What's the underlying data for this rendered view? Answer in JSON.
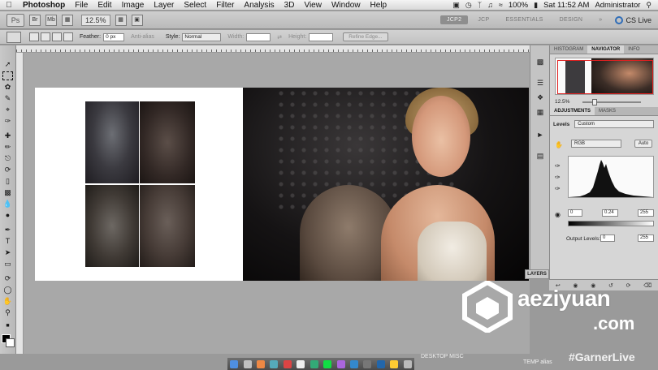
{
  "menubar": {
    "app": "Photoshop",
    "items": [
      "File",
      "Edit",
      "Image",
      "Layer",
      "Select",
      "Filter",
      "Analysis",
      "3D",
      "View",
      "Window",
      "Help"
    ],
    "battery": "100%",
    "clock": "Sat 11:52 AM",
    "user": "Administrator"
  },
  "appbar": {
    "ps": "Ps",
    "zoom": "12.5%",
    "workspaces": [
      "JCP2",
      "JCP",
      "ESSENTIALS",
      "DESIGN",
      "»"
    ],
    "cslive": "CS Live"
  },
  "options": {
    "feather_label": "Feather:",
    "feather_value": "0 px",
    "antialias": "Anti-alias",
    "style_label": "Style:",
    "style_value": "Normal",
    "width_label": "Width:",
    "height_label": "Height:",
    "refine": "Refine Edge..."
  },
  "panels": {
    "top_tabs": [
      "HISTOGRAM",
      "NAVIGATOR",
      "INFO"
    ],
    "nav_zoom": "12.5%",
    "adj_tabs": [
      "ADJUSTMENTS",
      "MASKS"
    ],
    "levels_label": "Levels",
    "preset": "Custom",
    "channel": "RGB",
    "auto": "Auto",
    "input_black": "0",
    "input_mid": "0.24",
    "input_white": "255",
    "output_label": "Output Levels:",
    "output_black": "0",
    "output_white": "255",
    "layers_tab": "LAYERS"
  },
  "watermark": {
    "name": "aeziyuan",
    "domain": ".com"
  },
  "bottom": {
    "desktop_misc": "DESKTOP MISC",
    "temp_alias": "TEMP alias",
    "hashtag": "#GarnerLive"
  },
  "colors": {
    "selection_red": "#e02020",
    "accent_blue": "#2f6db8"
  }
}
